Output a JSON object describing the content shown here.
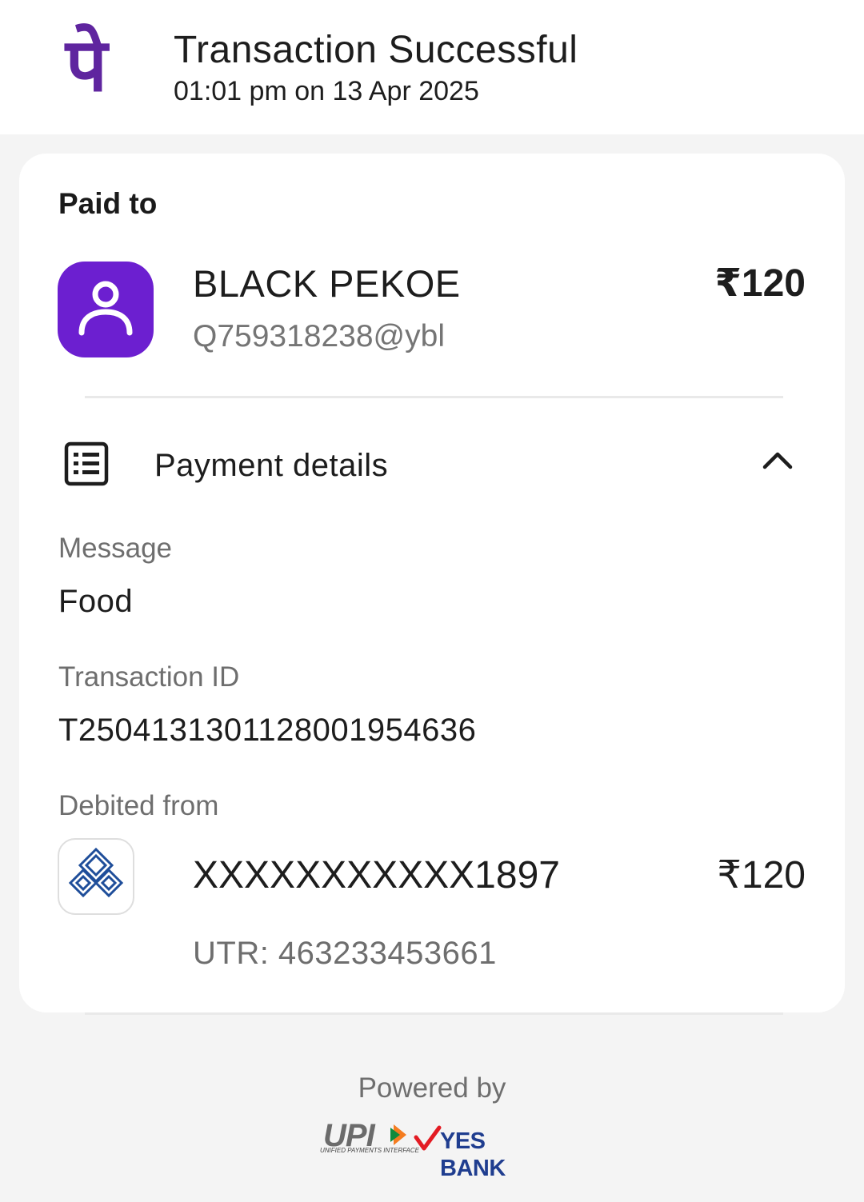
{
  "header": {
    "logo_glyph": "पे",
    "title": "Transaction Successful",
    "datetime": "01:01 pm on 13 Apr 2025"
  },
  "card": {
    "paid_to_label": "Paid to",
    "payee": {
      "icon": "person-icon",
      "name": "BLACK PEKOE",
      "vpa": "Q759318238@ybl",
      "amount": "₹120"
    },
    "payment_details": {
      "icon": "receipt-list-icon",
      "label": "Payment details",
      "chevron": "chevron-up-icon",
      "expanded": true
    },
    "fields": {
      "message_label": "Message",
      "message_value": "Food",
      "transaction_id_label": "Transaction ID",
      "transaction_id_value": "T2504131301128001954636",
      "debited_from_label": "Debited from"
    },
    "debit": {
      "bank_icon": "bank-of-india-logo",
      "account": "XXXXXXXXXXX1897",
      "amount": "₹120",
      "utr": "UTR: 463233453661"
    }
  },
  "footer": {
    "powered_by": "Powered by",
    "upi_text": "UPI",
    "upi_tagline": "UNIFIED PAYMENTS INTERFACE",
    "bank_text": "YES BANK"
  },
  "colors": {
    "brand_purple": "#5f259f",
    "avatar_purple": "#6c1fd0",
    "background": "#f4f4f4",
    "card": "#ffffff",
    "muted_text": "#6e6e6e",
    "yes_bank_blue": "#1f3d8f",
    "yes_bank_red": "#e31b23"
  }
}
